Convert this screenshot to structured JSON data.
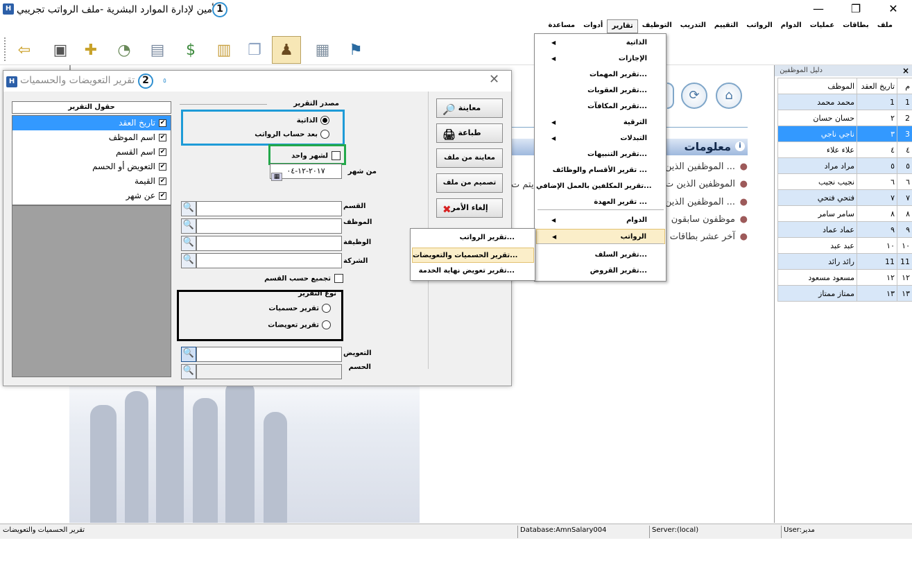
{
  "window": {
    "title": "الأمين لإدارة الموارد البشرية -ملف الرواتب تجريبي",
    "app_icon": "H",
    "badge1": "1",
    "minimize": "—",
    "maximize": "❐",
    "close": "✕"
  },
  "menubar": [
    "ملف",
    "بطاقات",
    "عمليات",
    "الدوام",
    "الرواتب",
    "التقييم",
    "التدريب",
    "التوظيف",
    "تقارير",
    "أدوات",
    "مساعدة"
  ],
  "active_menu": "تقارير",
  "toolbar_icons": [
    "exit-icon",
    "employee-card-icon",
    "attendance-icon",
    "clock-icon",
    "calendar-clock-icon",
    "salary-money-icon",
    "books-icon",
    "documents-icon",
    "users-report-icon",
    "calculator-icon",
    "bookmark-icon"
  ],
  "reports_menu": {
    "items": [
      {
        "label": "الذاتية",
        "submenu": true
      },
      {
        "label": "الإجازات",
        "submenu": true
      },
      {
        "label": "تقرير المهمات..."
      },
      {
        "label": "تقرير العقوبات..."
      },
      {
        "label": "تقرير المكافآت..."
      },
      {
        "label": "الترقية",
        "submenu": true
      },
      {
        "label": "التبدلات",
        "submenu": true
      },
      {
        "label": "تقرير التنبيهات..."
      },
      {
        "label": "تقرير الأقسام والوظائف ..."
      },
      {
        "label": "تقرير المكلفين بالعمل الإضافي..."
      },
      {
        "label": "تقرير العهدة ..."
      },
      {
        "label": "الدوام",
        "submenu": true
      },
      {
        "label": "الرواتب",
        "submenu": true,
        "hover": true
      },
      {
        "label": "تقرير السلف..."
      },
      {
        "label": "تقرير القروض..."
      }
    ],
    "arrow": "◀"
  },
  "salary_submenu": [
    "تقرير الرواتب...",
    "تقرير الحسميات والتعويضات...",
    "تقرير تعويض نهاية الخدمة..."
  ],
  "main": {
    "info_title": "معلومات",
    "info_items": [
      "الموظفين الذين ...",
      "الموظفين الذين ت",
      "الموظفين الذين ...",
      "موظفون سابقون",
      "آخر عشر بطاقات"
    ],
    "info_text_fragment": "م يتم ت",
    "home_icon": "⌂",
    "refresh_icon": "⟳",
    "info_icon": "i",
    "bullet": "●"
  },
  "employee_panel": {
    "title": "دليل الموظفين",
    "close": "×",
    "columns": [
      "م",
      "تاريخ العقد",
      "الموظف"
    ],
    "rows": [
      [
        "1",
        "1",
        "محمد محمد"
      ],
      [
        "2",
        "٢",
        "حسان حسان"
      ],
      [
        "3",
        "٣",
        "ناجي ناجي"
      ],
      [
        "٤",
        "٤",
        "علاء علاء"
      ],
      [
        "٥",
        "٥",
        "مراد مراد"
      ],
      [
        "٦",
        "٦",
        "نجيب نجيب"
      ],
      [
        "٧",
        "٧",
        "فتحي فتحي"
      ],
      [
        "٨",
        "٨",
        "سامر سامر"
      ],
      [
        "٩",
        "٩",
        "عماد عماد"
      ],
      [
        "١٠",
        "١٠",
        "عبد عبد"
      ],
      [
        "11",
        "11",
        "رائد رائد"
      ],
      [
        "١٢",
        "١٢",
        "مسعود مسعود"
      ],
      [
        "١٣",
        "١٣",
        "ممتاز ممتاز"
      ]
    ],
    "selected_row": 2
  },
  "dialog": {
    "title": "تقرير التعويضات والحسميات",
    "badge2": "2",
    "close": "✕",
    "dot": "٥",
    "fields_header": "حقول التقرير",
    "fields": [
      "تاريخ العقد",
      "اسم الموظف",
      "اسم القسم",
      "التعويض أو الحسم",
      "القيمة",
      "عن شهر"
    ],
    "check": "✔",
    "source_title": "مصدر التقرير",
    "source_options": [
      "الذاتية",
      "بعد حساب الرواتب"
    ],
    "single_month": "لشهر واحد",
    "from_month_label": "من شهر",
    "from_month_value": "٢٠١٧-١٢-٠٤",
    "filters": [
      "القسم",
      "الموظف",
      "الوظيفة",
      "الشركة"
    ],
    "group_by_dept": "تجميع حسب القسم",
    "report_type_title": "نوع التقرير",
    "report_types": [
      "تقرير حسميات",
      "تقرير تعويضات"
    ],
    "compensation_label": "التعويض",
    "deduction_label": "الحسم",
    "buttons": {
      "preview": "معاينة",
      "print": "طباعة",
      "preview_file": "معاينة من ملف",
      "design_file": "تصميم من ملف",
      "cancel": "إلغاء الأمر"
    },
    "search_glyph": "🔍",
    "calendar_glyph": "▦",
    "preview_glyph": "🔎",
    "print_glyph": "🖨",
    "cancel_glyph": "✖",
    "highlight_colors": {
      "source": "#1e9bd7",
      "single_month": "#23a84a",
      "report_type": "#000000"
    }
  },
  "statusbar": {
    "left": "تقرير الحسميات والتعويضات",
    "database": "Database:AmnSalary004",
    "server": "Server:(local)",
    "user": "User:مدير"
  }
}
